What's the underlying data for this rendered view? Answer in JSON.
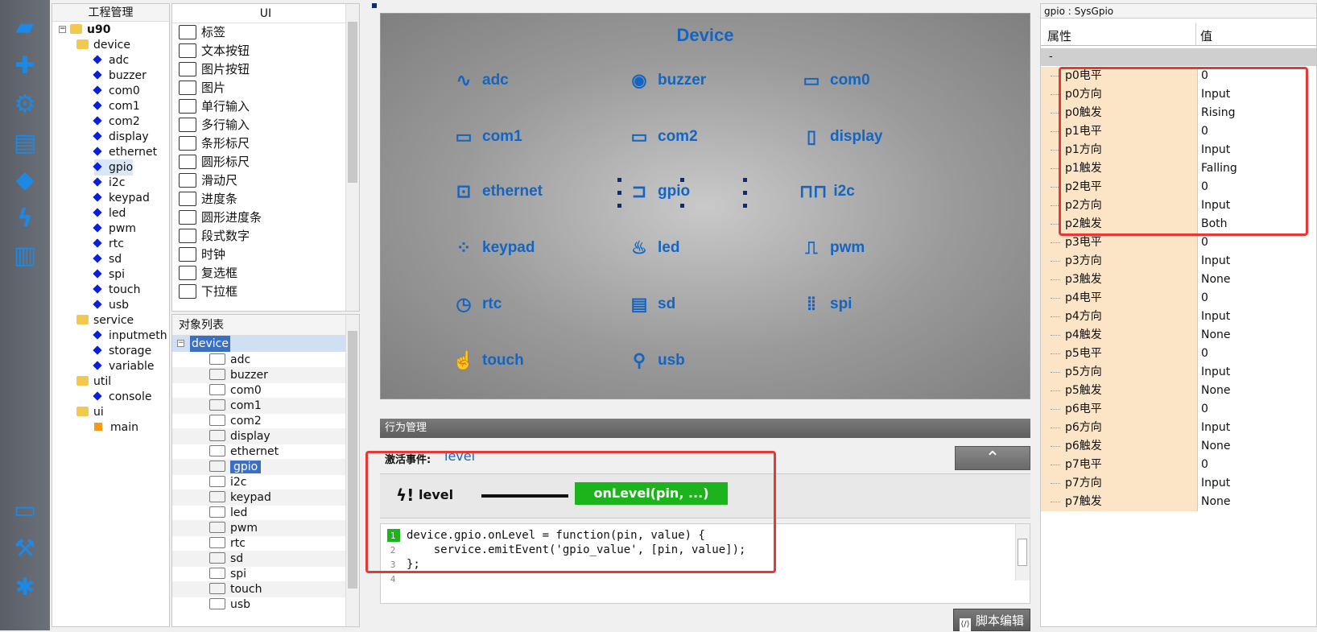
{
  "toolbar": {
    "icons": [
      "folder-open-icon",
      "add-icon",
      "settings-icon",
      "document-icon",
      "gem-icon",
      "lightning-icon",
      "book-icon",
      "monitor-icon",
      "hammer-icon",
      "bug-icon"
    ]
  },
  "project": {
    "title": "工程管理",
    "root": "u90",
    "device_folder": "device",
    "device_items": [
      "adc",
      "buzzer",
      "com0",
      "com1",
      "com2",
      "display",
      "ethernet",
      "gpio",
      "i2c",
      "keypad",
      "led",
      "pwm",
      "rtc",
      "sd",
      "spi",
      "touch",
      "usb"
    ],
    "service_folder": "service",
    "service_items": [
      "inputmeth",
      "storage",
      "variable"
    ],
    "util_folder": "util",
    "util_items": [
      "console"
    ],
    "ui_folder": "ui",
    "ui_items": [
      "main"
    ]
  },
  "ui_panel": {
    "title": "UI",
    "items": [
      "标签",
      "文本按钮",
      "图片按钮",
      "图片",
      "单行输入",
      "多行输入",
      "条形标尺",
      "圆形标尺",
      "滑动尺",
      "进度条",
      "圆形进度条",
      "段式数字",
      "时钟",
      "复选框",
      "下拉框"
    ]
  },
  "object_list": {
    "title": "对象列表",
    "root": "device",
    "items": [
      "adc",
      "buzzer",
      "com0",
      "com1",
      "com2",
      "display",
      "ethernet",
      "gpio",
      "i2c",
      "keypad",
      "led",
      "pwm",
      "rtc",
      "sd",
      "spi",
      "touch",
      "usb"
    ],
    "selected": "gpio"
  },
  "canvas": {
    "title": "Device",
    "devices": [
      {
        "label": "adc",
        "glyph": "∿"
      },
      {
        "label": "buzzer",
        "glyph": "◉"
      },
      {
        "label": "com0",
        "glyph": "▭"
      },
      {
        "label": "com1",
        "glyph": "▭"
      },
      {
        "label": "com2",
        "glyph": "▭"
      },
      {
        "label": "display",
        "glyph": "▯"
      },
      {
        "label": "ethernet",
        "glyph": "⊡"
      },
      {
        "label": "gpio",
        "glyph": "⊐"
      },
      {
        "label": "i2c",
        "glyph": "⊓⊓"
      },
      {
        "label": "keypad",
        "glyph": "⁘"
      },
      {
        "label": "led",
        "glyph": "♨"
      },
      {
        "label": "pwm",
        "glyph": "⎍"
      },
      {
        "label": "rtc",
        "glyph": "◷"
      },
      {
        "label": "sd",
        "glyph": "▤"
      },
      {
        "label": "spi",
        "glyph": "⦙⦙"
      },
      {
        "label": "touch",
        "glyph": "☝"
      },
      {
        "label": "usb",
        "glyph": "⚲"
      }
    ]
  },
  "behavior": {
    "title": "行为管理",
    "event_label": "激活事件:",
    "event_value": "level",
    "collapse_icon": "double-chevron-up-icon",
    "event_name": "level",
    "handler": "onLevel(pin, ...)",
    "code_lines": [
      {
        "n": "1",
        "text": "device.gpio.onLevel = function(pin, value) {"
      },
      {
        "n": "2",
        "text": "    service.emitEvent('gpio_value', [pin, value]);"
      },
      {
        "n": "3",
        "text": "};"
      },
      {
        "n": "4",
        "text": ""
      }
    ],
    "script_button": "脚本编辑",
    "colors": {
      "handler_bg": "#1db31d",
      "highlight": "#e53935",
      "keyword": "#b8860b",
      "string": "#0d8a2d"
    }
  },
  "properties": {
    "title": "gpio : SysGpio",
    "col_name": "属性",
    "col_value": "值",
    "group": "-",
    "rows": [
      {
        "name": "p0电平",
        "value": "0"
      },
      {
        "name": "p0方向",
        "value": "Input"
      },
      {
        "name": "p0触发",
        "value": "Rising"
      },
      {
        "name": "p1电平",
        "value": "0"
      },
      {
        "name": "p1方向",
        "value": "Input"
      },
      {
        "name": "p1触发",
        "value": "Falling"
      },
      {
        "name": "p2电平",
        "value": "0"
      },
      {
        "name": "p2方向",
        "value": "Input"
      },
      {
        "name": "p2触发",
        "value": "Both"
      },
      {
        "name": "p3电平",
        "value": "0"
      },
      {
        "name": "p3方向",
        "value": "Input"
      },
      {
        "name": "p3触发",
        "value": "None"
      },
      {
        "name": "p4电平",
        "value": "0"
      },
      {
        "name": "p4方向",
        "value": "Input"
      },
      {
        "name": "p4触发",
        "value": "None"
      },
      {
        "name": "p5电平",
        "value": "0"
      },
      {
        "name": "p5方向",
        "value": "Input"
      },
      {
        "name": "p5触发",
        "value": "None"
      },
      {
        "name": "p6电平",
        "value": "0"
      },
      {
        "name": "p6方向",
        "value": "Input"
      },
      {
        "name": "p6触发",
        "value": "None"
      },
      {
        "name": "p7电平",
        "value": "0"
      },
      {
        "name": "p7方向",
        "value": "Input"
      },
      {
        "name": "p7触发",
        "value": "None"
      }
    ]
  }
}
